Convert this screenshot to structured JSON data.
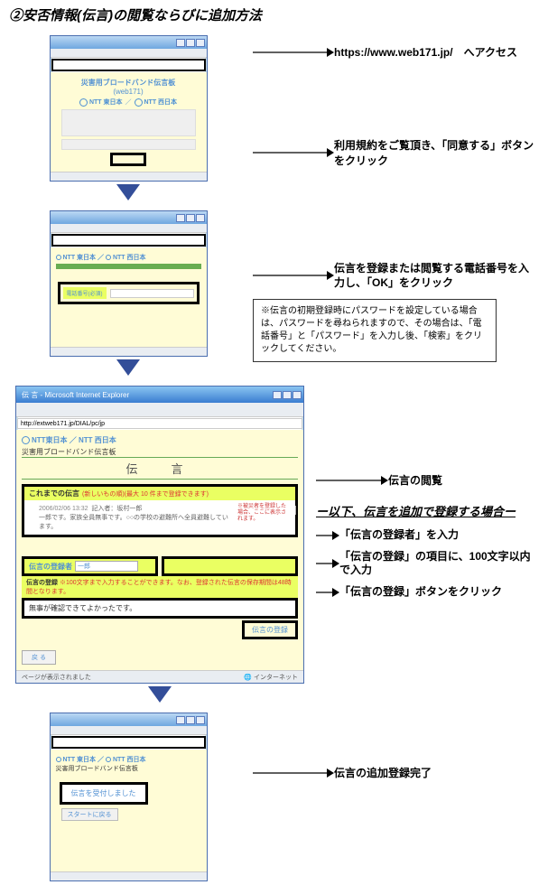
{
  "title": "②安否情報(伝言)の閲覧ならびに追加方法",
  "step1": {
    "url": "https://www.web171.jp/",
    "label_suffix": "　へアクセス",
    "banner_l1": "災害用ブロードバンド伝言板",
    "banner_l2": "(web171)",
    "provider_e": "NTT 東日本",
    "provider_w": "NTT 西日本",
    "sep": "／",
    "agree_note": "利用規約をご覧頂き、「同意する」ボタンをクリック"
  },
  "step2": {
    "phone_label": "電話番号(必須)",
    "note": "伝言を登録または閲覧する電話番号を入力し、「OK」をクリック",
    "note_box": "※伝言の初期登録時にパスワードを設定している場合は、パスワードを尋ねられますので、その場合は、「電話番号」と「パスワード」を入力し後、「検索」をクリックしてください。"
  },
  "step3": {
    "win_title": "伝 言 - Microsoft Internet Explorer",
    "url_text": "http://extweb171.jp/DIAL/pc/jp",
    "top_line": "NTT東日本 ／ NTT 西日本",
    "sub_line": "災害用ブロードバンド伝言板",
    "page_h": "伝　言",
    "prev_h": "これまでの伝言",
    "prev_note": "(新しいもの順)(最大 10 件まで登録できます)",
    "msg_date": "2006/02/06 13:32",
    "msg_author": "記入者：坂村一郎",
    "msg_body": "一郎です。家族全員無事です。○○の学校の避難所へ全員避難しています。",
    "side_red": "※被災者を登録した場合、ここに表示されます。",
    "view_label": "伝言の閲覧",
    "divider": "ー以下、伝言を追加で登録する場合ー",
    "reg_h": "伝言の登録者",
    "reg_name": "一郎",
    "anno_reg": "「伝言の登録者」を入力",
    "body_h": "伝言の登録",
    "body_note": "※100文字まで入力することができます。なお、登録された伝言の保存期間は48時間となります。",
    "body_text": "無事が確認できてよかったです。",
    "anno_body": "「伝言の登録」の項目に、100文字以内で入力",
    "submit": "伝言の登録",
    "anno_submit": "「伝言の登録」ボタンをクリック",
    "back": "戻 る",
    "status": "ページが表示されました",
    "net": "インターネット"
  },
  "step4": {
    "confirm": "伝言を受付しました",
    "btn": "スタートに戻る",
    "label": "伝言の追加登録完了"
  }
}
